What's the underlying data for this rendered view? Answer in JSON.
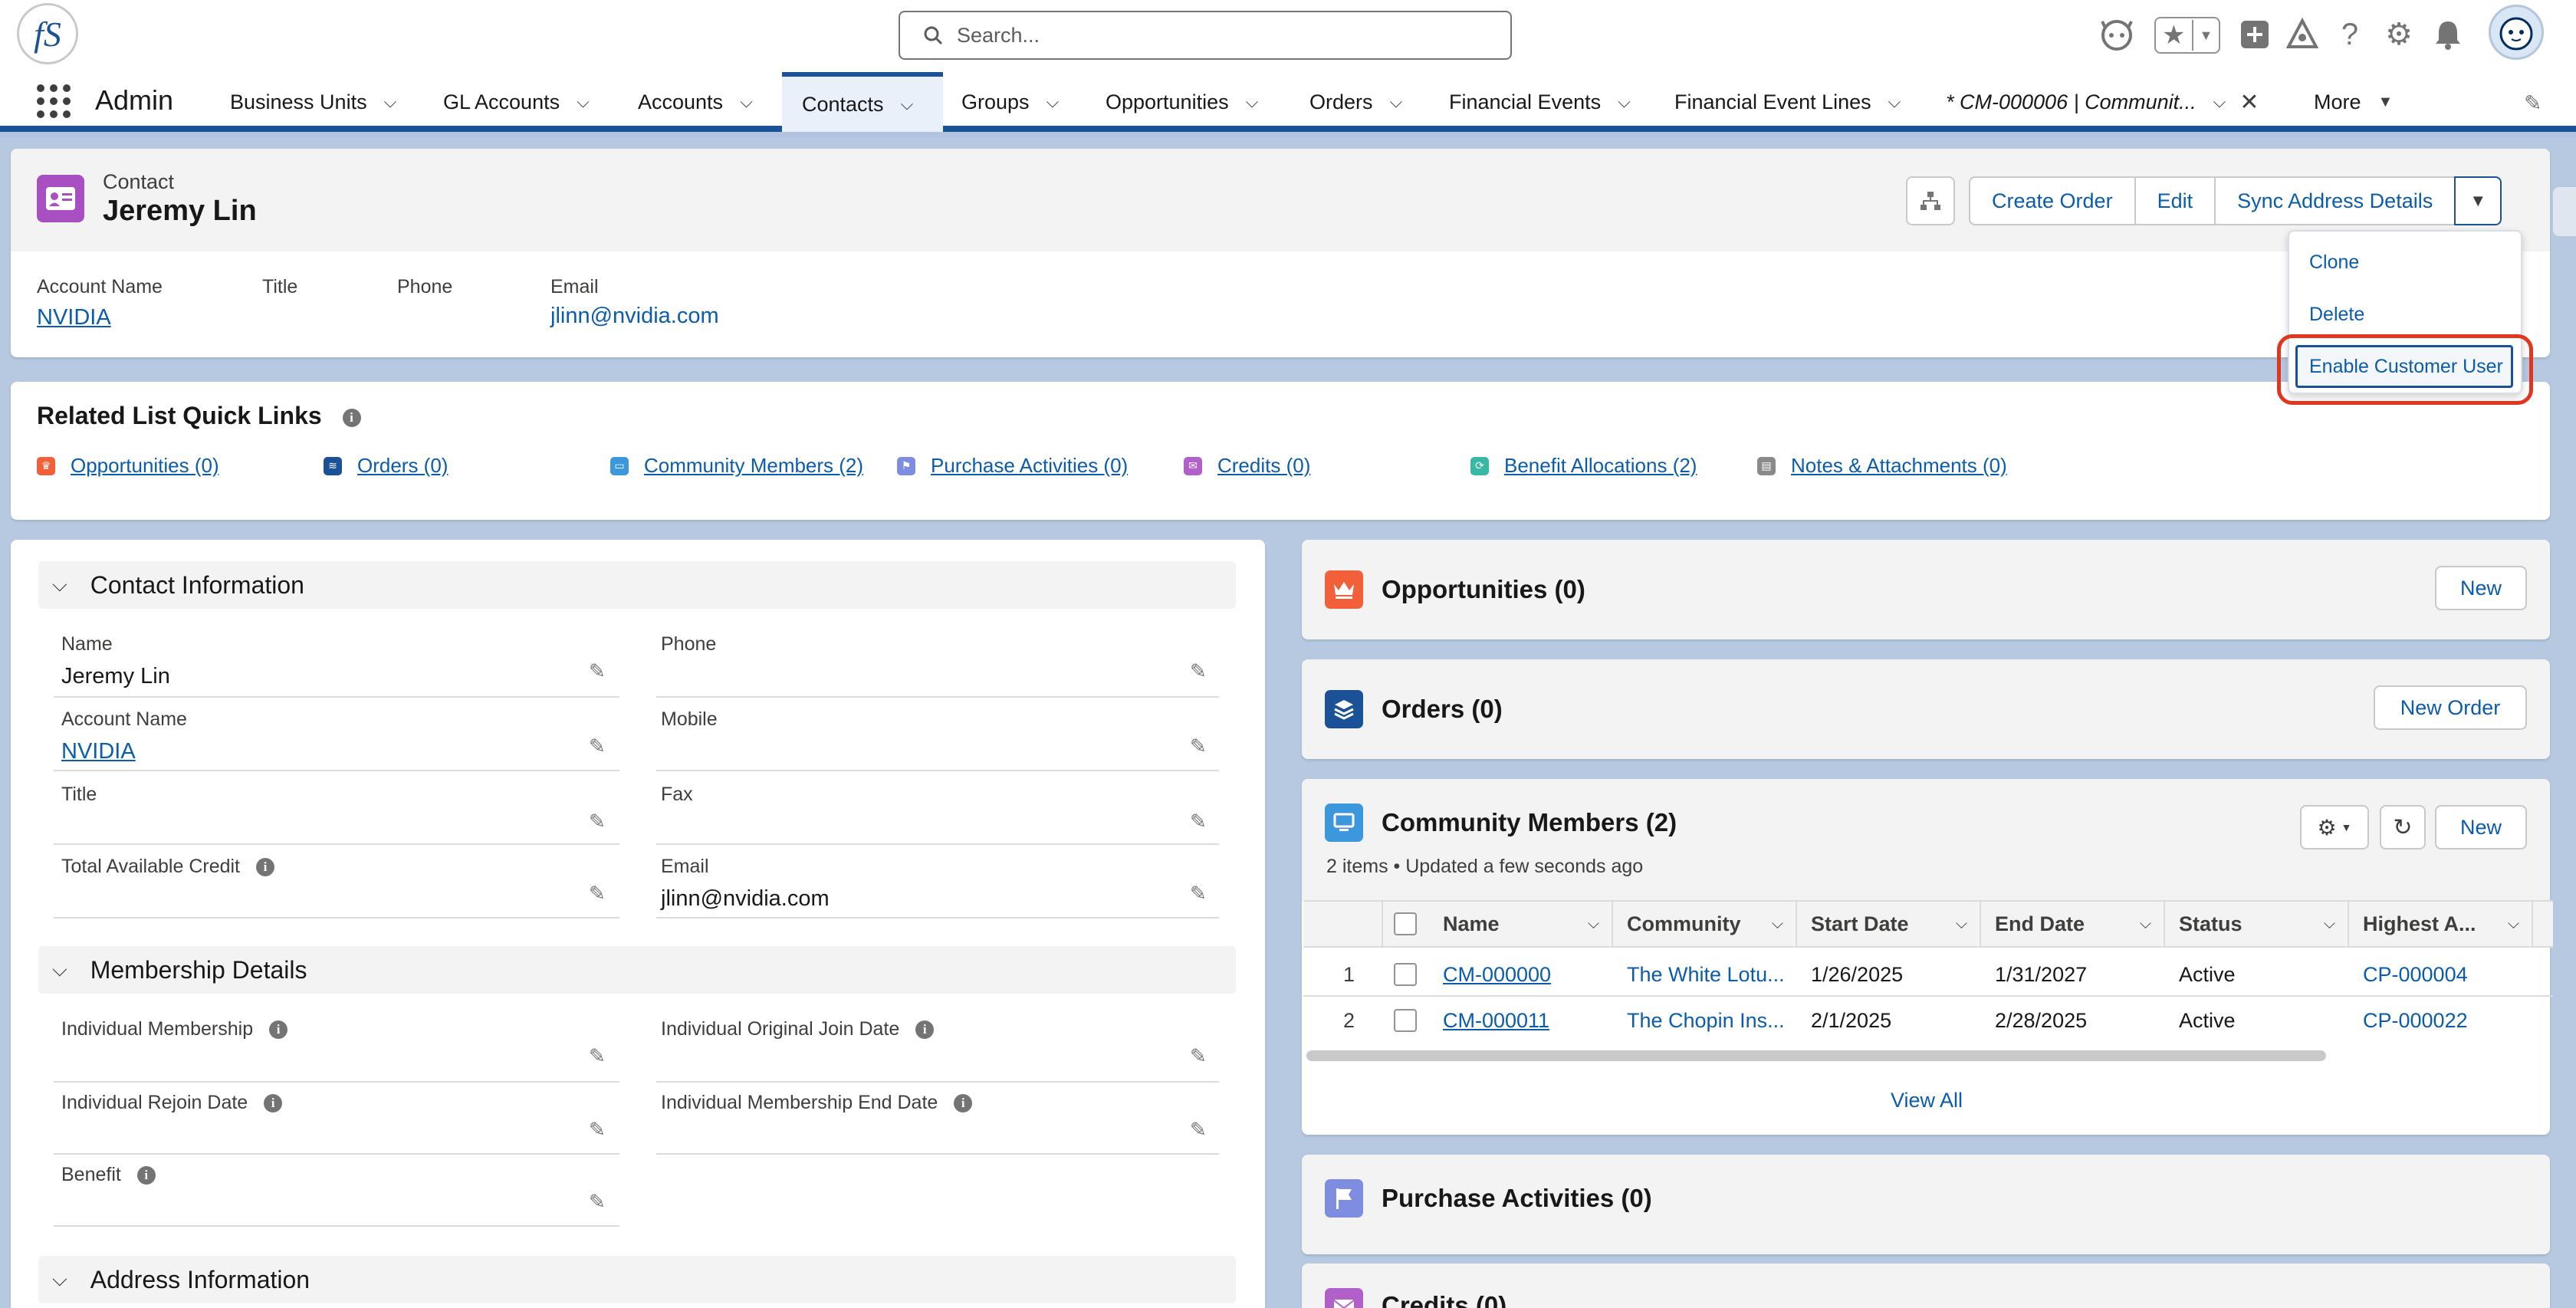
{
  "header": {
    "search_placeholder": "Search...",
    "app_name": "Admin"
  },
  "nav": {
    "items": [
      {
        "label": "Business Units"
      },
      {
        "label": "GL Accounts"
      },
      {
        "label": "Accounts"
      },
      {
        "label": "Contacts"
      },
      {
        "label": "Groups"
      },
      {
        "label": "Opportunities"
      },
      {
        "label": "Orders"
      },
      {
        "label": "Financial Events"
      },
      {
        "label": "Financial Event Lines"
      },
      {
        "label": "* CM-000006 | Communit..."
      },
      {
        "label": "More"
      }
    ]
  },
  "record": {
    "object_label": "Contact",
    "name": "Jeremy Lin",
    "actions": {
      "create_order": "Create Order",
      "edit": "Edit",
      "sync": "Sync Address Details"
    },
    "menu": {
      "clone": "Clone",
      "delete": "Delete",
      "enable_customer_user": "Enable Customer User"
    },
    "highlights": {
      "account_name_label": "Account Name",
      "account_name": "NVIDIA",
      "title_label": "Title",
      "phone_label": "Phone",
      "email_label": "Email",
      "email": "jlinn@nvidia.com"
    }
  },
  "quick_links": {
    "title": "Related List Quick Links",
    "links": [
      {
        "label": "Opportunities (0)",
        "color": "#f2603a"
      },
      {
        "label": "Orders (0)",
        "color": "#1b5297"
      },
      {
        "label": "Community Members (2)",
        "color": "#3c97dd"
      },
      {
        "label": "Purchase Activities (0)",
        "color": "#7f8de1"
      },
      {
        "label": "Credits (0)",
        "color": "#b260c9"
      },
      {
        "label": "Benefit Allocations (2)",
        "color": "#39b9a5"
      },
      {
        "label": "Notes & Attachments (0)",
        "color": "#8a8a8a"
      }
    ]
  },
  "details": {
    "contact_info": {
      "header": "Contact Information",
      "name_label": "Name",
      "name": "Jeremy Lin",
      "phone_label": "Phone",
      "account_label": "Account Name",
      "account": "NVIDIA",
      "mobile_label": "Mobile",
      "title_label": "Title",
      "fax_label": "Fax",
      "credit_label": "Total Available Credit",
      "email_label": "Email",
      "email": "jlinn@nvidia.com"
    },
    "membership": {
      "header": "Membership Details",
      "ind_membership": "Individual Membership",
      "orig_join": "Individual Original Join Date",
      "rejoin": "Individual Rejoin Date",
      "end_date": "Individual Membership End Date",
      "benefit": "Benefit"
    },
    "address": {
      "header": "Address Information"
    }
  },
  "related": {
    "opportunities": {
      "title": "Opportunities (0)",
      "new": "New"
    },
    "orders": {
      "title": "Orders (0)",
      "new": "New Order"
    },
    "community": {
      "title": "Community Members (2)",
      "subtitle": "2 items • Updated a few seconds ago",
      "new": "New",
      "columns": [
        "Name",
        "Community",
        "Start Date",
        "End Date",
        "Status",
        "Highest A..."
      ],
      "rows": [
        {
          "num": "1",
          "name": "CM-000000",
          "community": "The White Lotu...",
          "start": "1/26/2025",
          "end": "1/31/2027",
          "status": "Active",
          "highest": "CP-000004"
        },
        {
          "num": "2",
          "name": "CM-000011",
          "community": "The Chopin Ins...",
          "start": "2/1/2025",
          "end": "2/28/2025",
          "status": "Active",
          "highest": "CP-000022"
        }
      ],
      "view_all": "View All"
    },
    "purchase": {
      "title": "Purchase Activities (0)"
    },
    "credits": {
      "title": "Credits (0)"
    }
  }
}
